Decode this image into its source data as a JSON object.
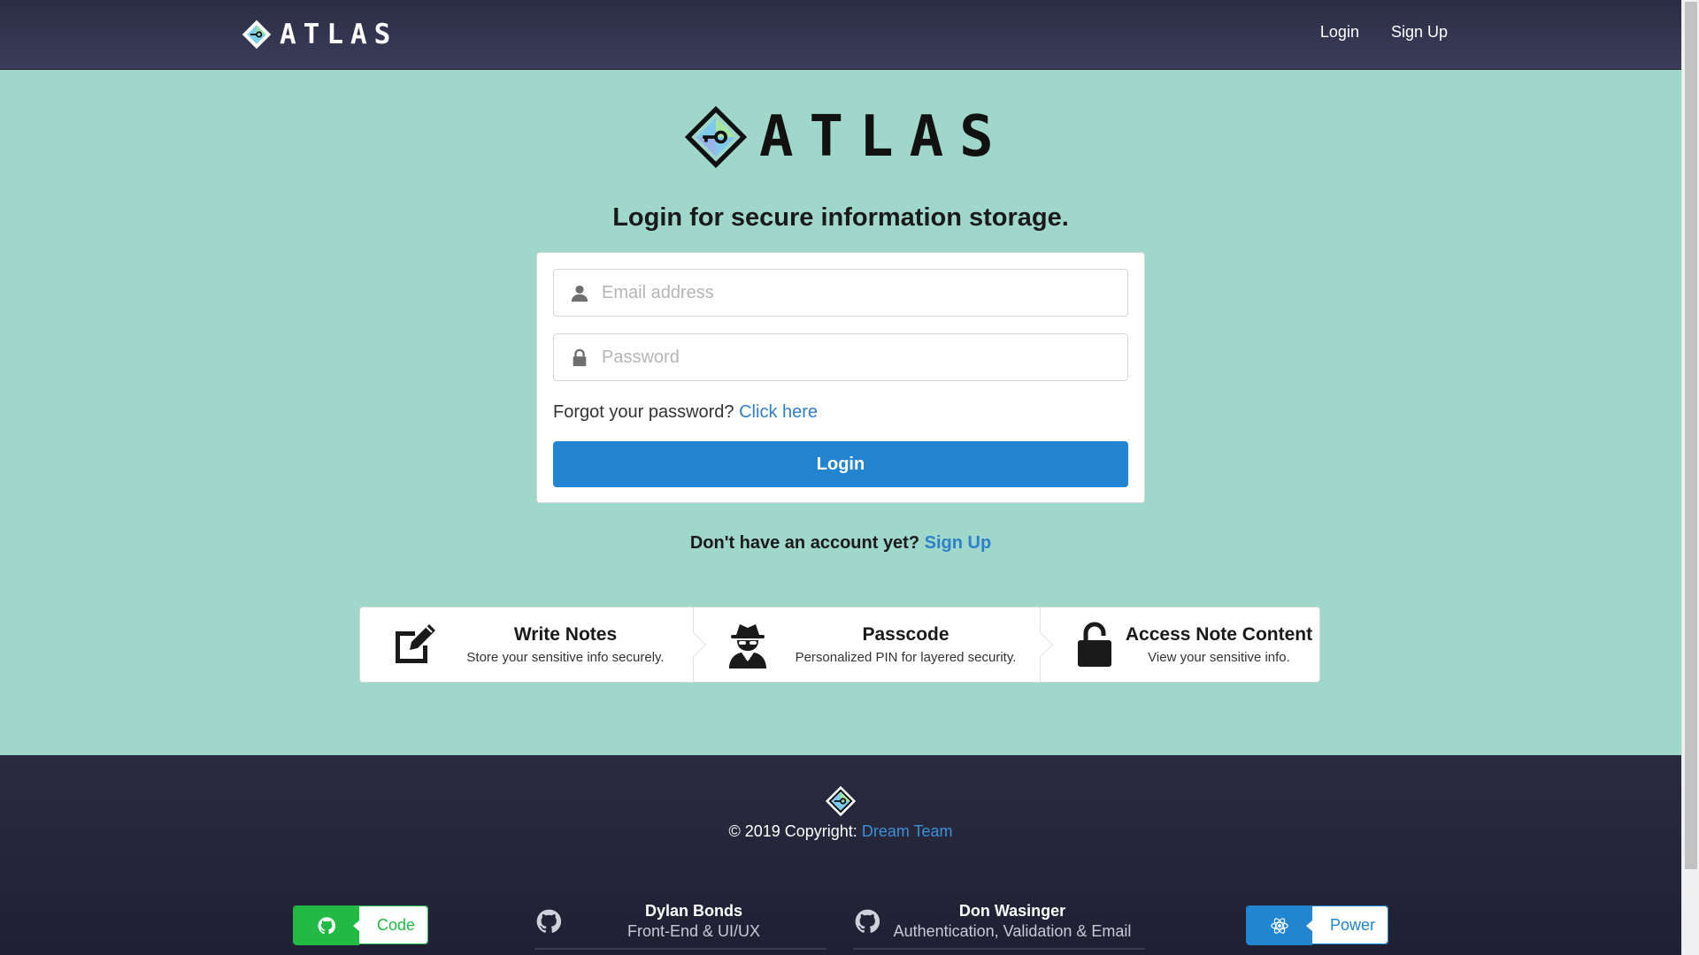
{
  "header": {
    "brand": "ATLAS",
    "nav": {
      "login": "Login",
      "signup": "Sign Up"
    }
  },
  "hero": {
    "logo_text": "ATLAS",
    "headline": "Login for secure information storage."
  },
  "form": {
    "email_placeholder": "Email address",
    "password_placeholder": "Password",
    "forgot_text": "Forgot your password?",
    "forgot_link": "Click here",
    "login_button": "Login"
  },
  "signup_prompt": {
    "text": "Don't have an account yet?",
    "link": "Sign Up"
  },
  "steps": [
    {
      "icon": "edit-icon",
      "title": "Write Notes",
      "description": "Store your sensitive info securely."
    },
    {
      "icon": "user-secret-icon",
      "title": "Passcode",
      "description": "Personalized PIN for layered security."
    },
    {
      "icon": "unlock-icon",
      "title": "Access Note Content",
      "description": "View your sensitive info."
    }
  ],
  "footer": {
    "copyright": "© 2019 Copyright:",
    "team": "Dream Team",
    "code_button": "Code",
    "power_button": "Power",
    "people": [
      {
        "name": "Dylan Bonds",
        "role": "Front-End & UI/UX"
      },
      {
        "name": "Don Wasinger",
        "role": "Authentication, Validation & Email"
      }
    ]
  },
  "colors": {
    "background": "#9fd8ca",
    "nav": "#2b2c45",
    "primary": "#2385d1",
    "link": "#2f80c8",
    "green": "#21ba45"
  }
}
